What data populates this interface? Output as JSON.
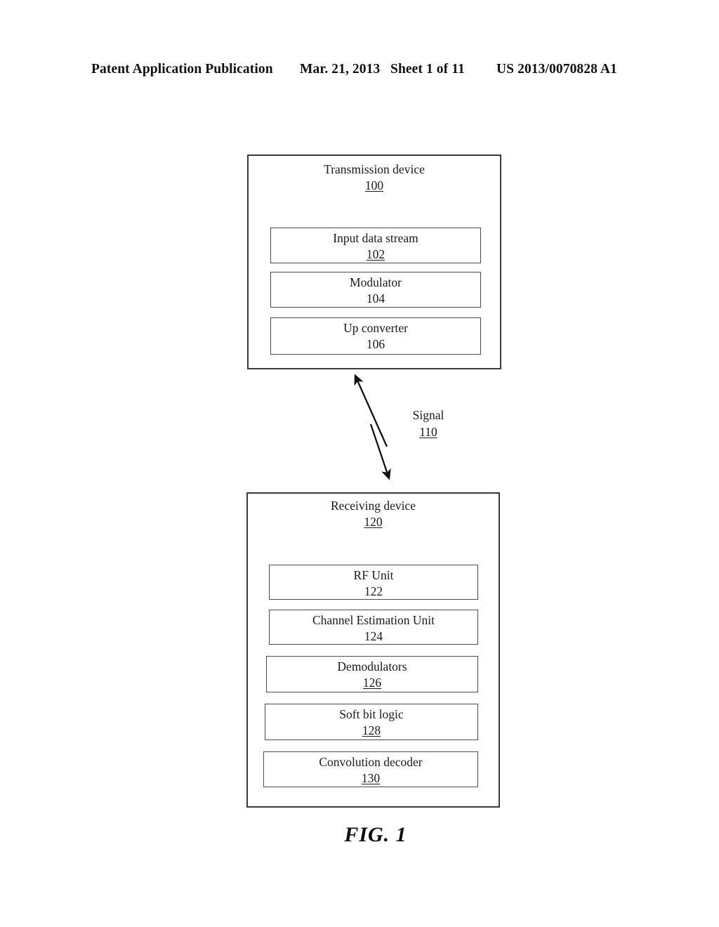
{
  "header": {
    "publication": "Patent Application Publication",
    "date": "Mar. 21, 2013",
    "sheet": "Sheet 1 of 11",
    "document_number": "US 2013/0070828 A1"
  },
  "figure": {
    "caption": "FIG. 1",
    "transmission_device": {
      "title": "Transmission device",
      "ref": "100",
      "blocks": [
        {
          "label": "Input data stream",
          "ref": "102",
          "ref_underlined": true
        },
        {
          "label": "Modulator",
          "ref": "104",
          "ref_underlined": false
        },
        {
          "label": "Up converter",
          "ref": "106",
          "ref_underlined": false
        }
      ]
    },
    "signal": {
      "label": "Signal",
      "ref": "110"
    },
    "receiving_device": {
      "title": "Receiving device",
      "ref": "120",
      "blocks": [
        {
          "label": "RF Unit",
          "ref": "122",
          "ref_underlined": false
        },
        {
          "label": "Channel Estimation Unit",
          "ref": "124",
          "ref_underlined": false
        },
        {
          "label": "Demodulators",
          "ref": "126",
          "ref_underlined": true
        },
        {
          "label": "Soft bit logic",
          "ref": "128",
          "ref_underlined": true
        },
        {
          "label": "Convolution decoder",
          "ref": "130",
          "ref_underlined": true
        }
      ]
    }
  },
  "colors": {
    "ink": "#1a1a1a",
    "box_border": "#3a3a3a",
    "page_background": "#ffffff"
  }
}
